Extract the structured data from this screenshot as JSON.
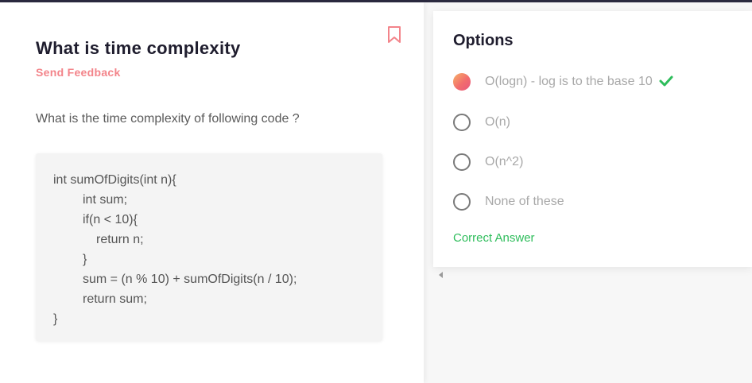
{
  "question": {
    "title": "What is time complexity",
    "feedback_label": "Send Feedback",
    "prompt": "What is the time complexity of following code ?",
    "code_lines": [
      "int sumOfDigits(int n){",
      "int sum;",
      "if(n < 10){",
      "return n;",
      "}",
      "sum = (n % 10) + sumOfDigits(n / 10);",
      "return sum;",
      "}"
    ]
  },
  "options": {
    "title": "Options",
    "items": [
      {
        "label": "O(logn) - log is to the base 10",
        "selected": true,
        "correct": true
      },
      {
        "label": "O(n)",
        "selected": false,
        "correct": false
      },
      {
        "label": "O(n^2)",
        "selected": false,
        "correct": false
      },
      {
        "label": "None of these",
        "selected": false,
        "correct": false
      }
    ],
    "result_label": "Correct Answer"
  },
  "colors": {
    "accent": "#f3848a",
    "correct": "#2ebd5b",
    "title": "#1f1d2e"
  },
  "icons": {
    "bookmark": "bookmark-icon",
    "check": "check-icon",
    "scroll": "chevron-left-icon"
  }
}
